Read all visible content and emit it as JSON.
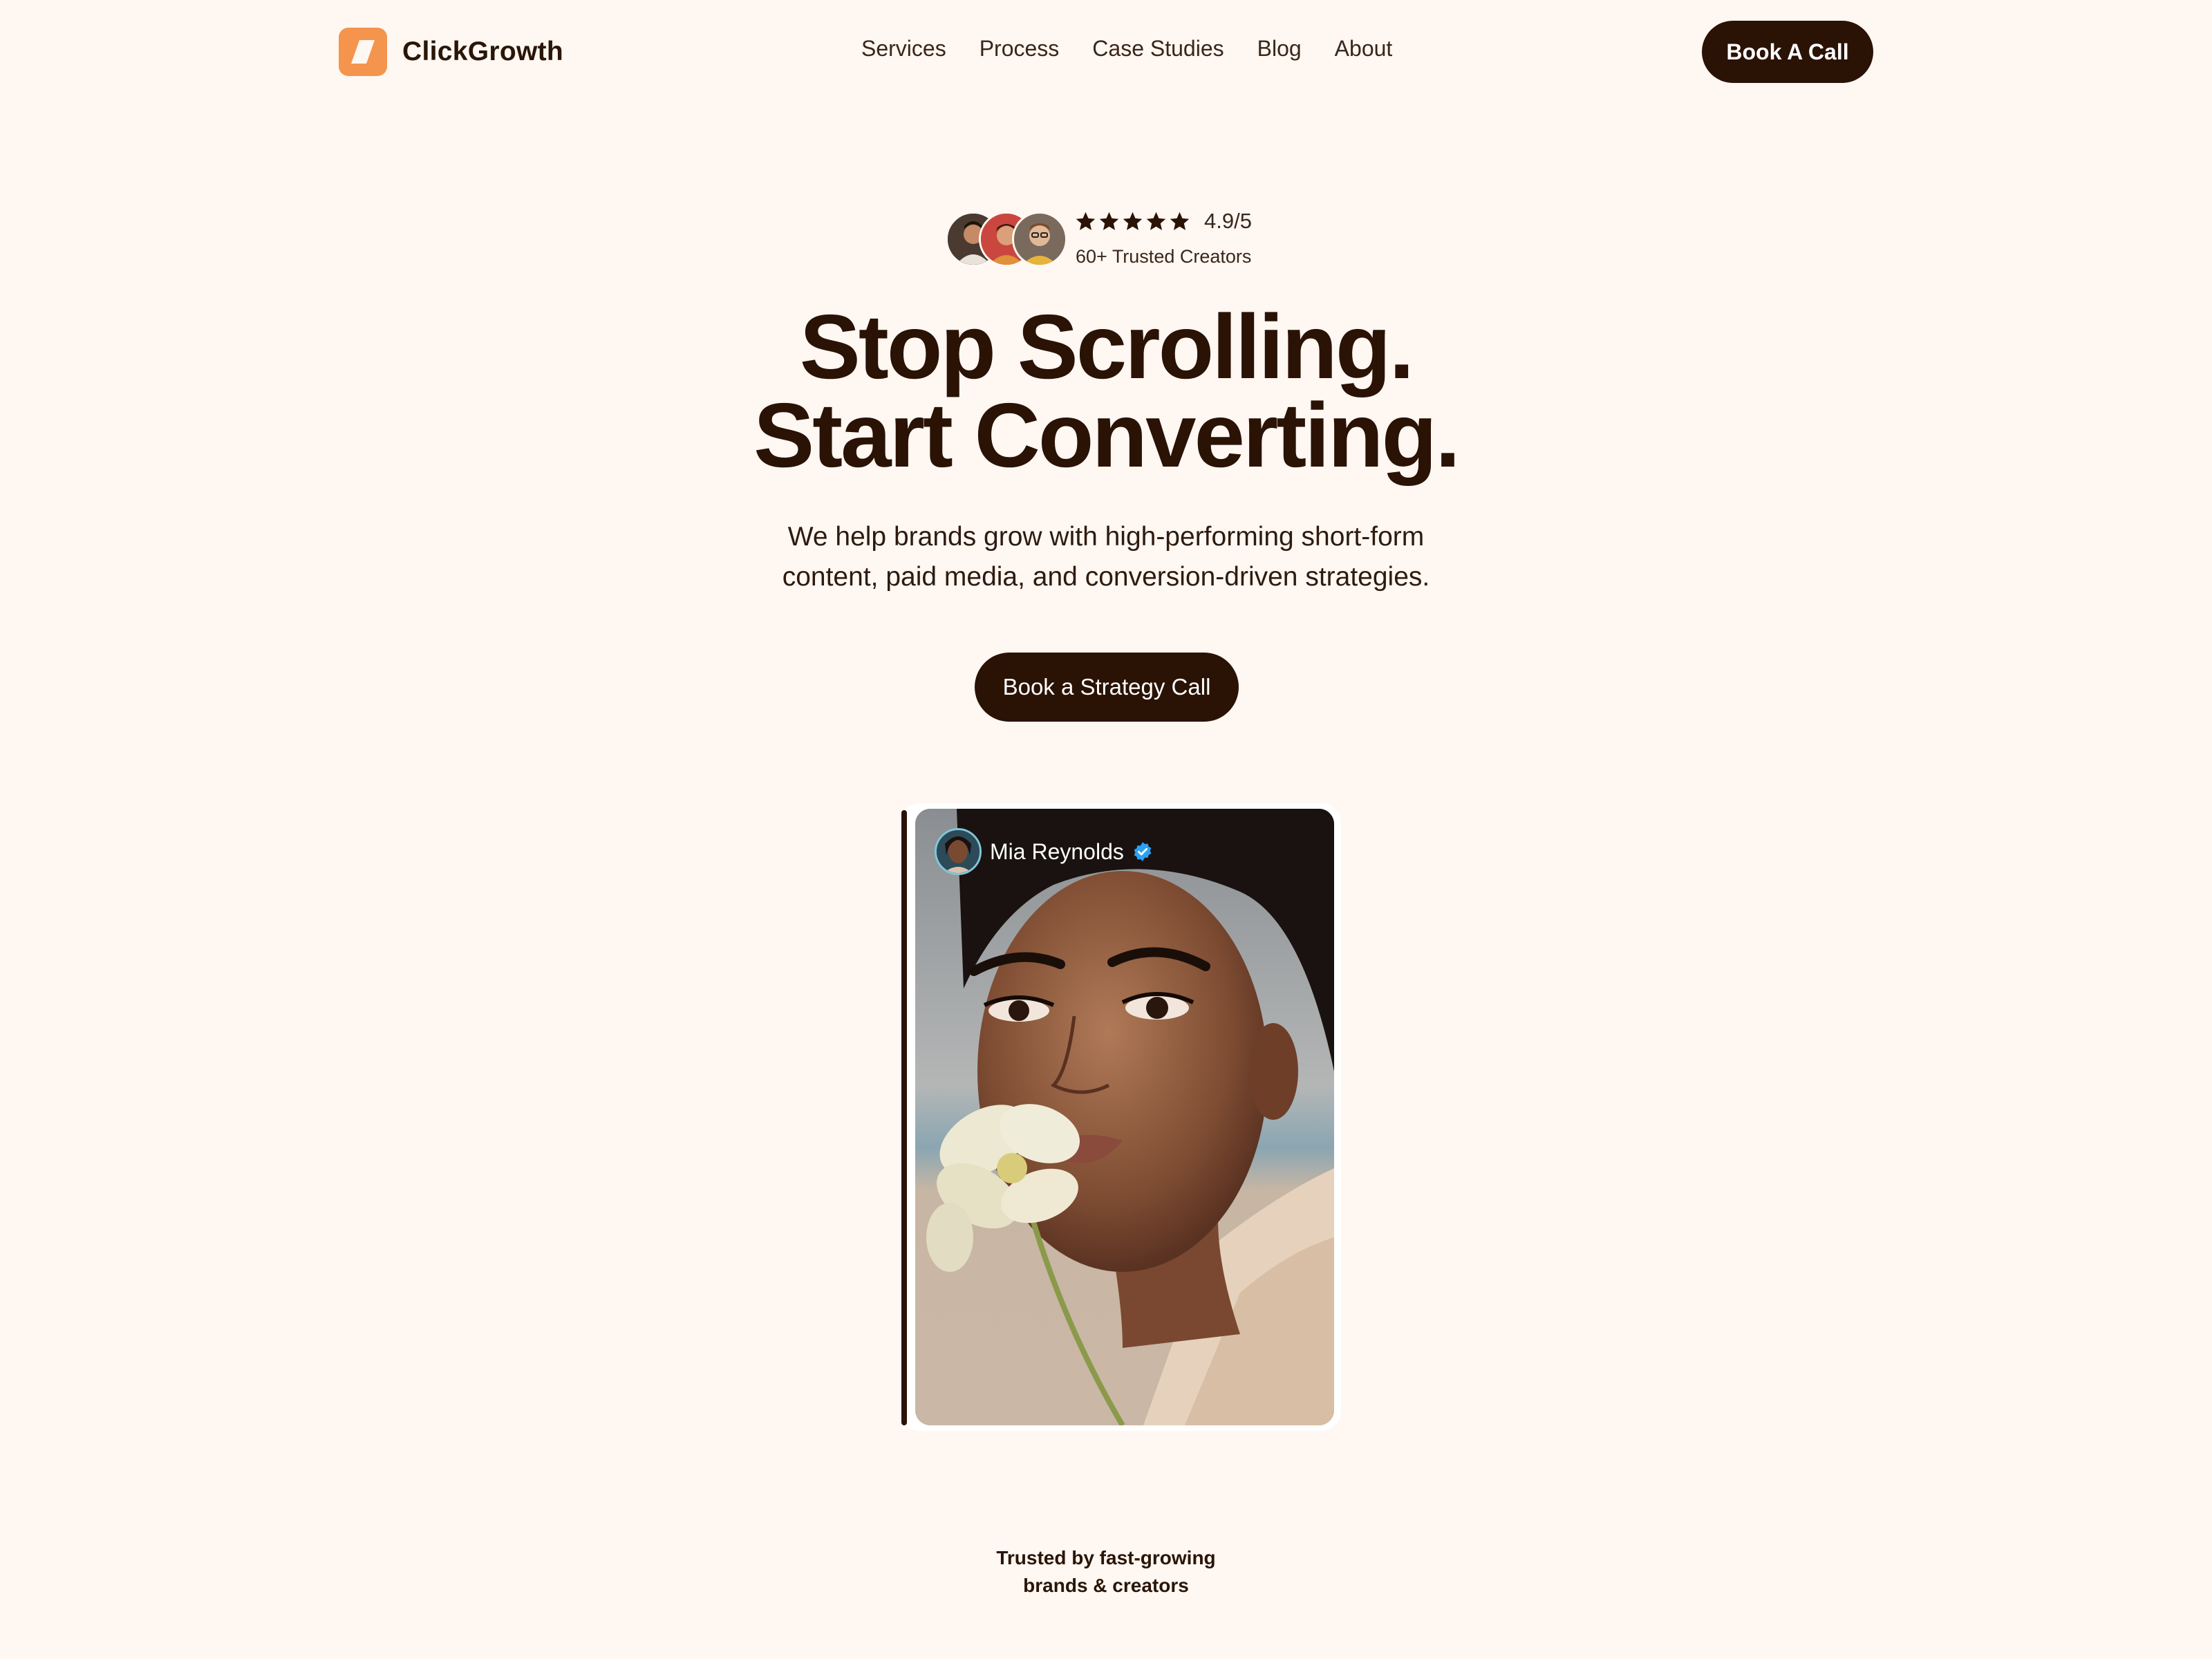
{
  "brand": {
    "name": "ClickGrowth",
    "accent_color": "#f4944d",
    "dark_color": "#2a1205",
    "background_color": "#fef7f2"
  },
  "nav": {
    "links": [
      "Services",
      "Process",
      "Case Studies",
      "Blog",
      "About"
    ],
    "cta_label": "Book A Call"
  },
  "rating": {
    "stars": 5,
    "value": "4.9/5",
    "subtitle": "60+ Trusted Creators"
  },
  "hero": {
    "title_line1": "Stop Scrolling.",
    "title_line2": "Start Converting.",
    "subtitle_line1": "We help brands grow with high-performing short-form",
    "subtitle_line2": "content, paid media, and conversion-driven strategies.",
    "cta_label": "Book a Strategy Call"
  },
  "card": {
    "creator_name": "Mia Reynolds",
    "verified_icon": "verified-badge-icon",
    "verified_color": "#2aa2f2"
  },
  "trusted": {
    "line1": "Trusted by fast-growing",
    "line2": "brands & creators"
  }
}
